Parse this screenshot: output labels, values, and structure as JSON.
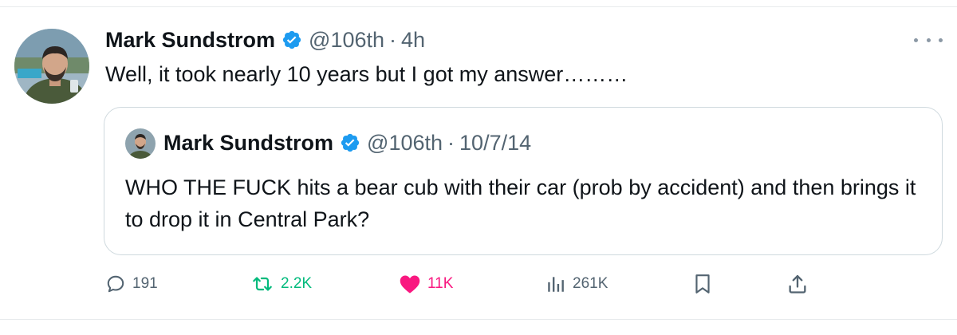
{
  "tweet": {
    "author_name": "Mark Sundstrom",
    "handle": "@106th",
    "separator": "·",
    "time": "4h",
    "text": "Well, it took nearly 10 years but I got my answer………"
  },
  "quoted": {
    "author_name": "Mark Sundstrom",
    "handle": "@106th",
    "separator": "·",
    "date": "10/7/14",
    "text": "WHO THE FUCK hits a bear cub with their car (prob by accident) and then brings it to drop it in Central Park?"
  },
  "actions": {
    "replies": "191",
    "reposts": "2.2K",
    "likes": "11K",
    "views": "261K"
  },
  "colors": {
    "verified": "#1d9bf0",
    "repost": "#00ba7c",
    "like": "#f91880",
    "muted": "#536471",
    "text": "#0f1419"
  },
  "icons": [
    "more-icon",
    "verified-icon",
    "reply-icon",
    "repost-icon",
    "like-icon",
    "views-icon",
    "bookmark-icon",
    "share-icon"
  ]
}
